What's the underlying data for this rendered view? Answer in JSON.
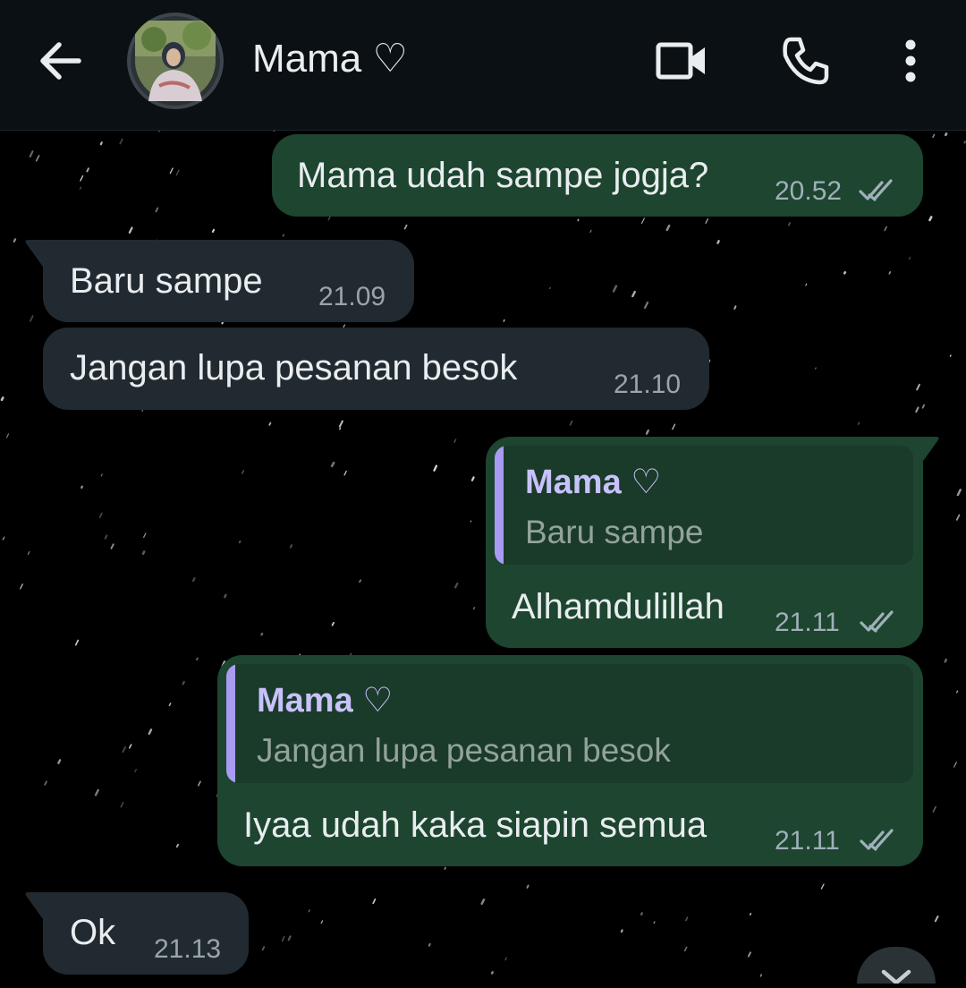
{
  "header": {
    "contact_name": "Mama ♡"
  },
  "icons": {
    "back": "arrow-left-icon",
    "avatar": "avatar",
    "video": "video-camera-icon",
    "call": "phone-icon",
    "menu": "more-vertical-icon",
    "read": "double-check-icon",
    "scroll": "chevron-down-icon"
  },
  "colors": {
    "outgoing_bubble": "#1d4530",
    "incoming_bubble": "#212a30",
    "quote_accent": "#a79cf2",
    "background": "#000000"
  },
  "messages": [
    {
      "direction": "outgoing",
      "text": "Mama udah sampe jogja?",
      "time": "20.52",
      "status": "read"
    },
    {
      "direction": "incoming",
      "text": "Baru sampe",
      "time": "21.09"
    },
    {
      "direction": "incoming",
      "text": "Jangan lupa  pesanan besok",
      "time": "21.10"
    },
    {
      "direction": "outgoing",
      "quote": {
        "author": "Mama ♡",
        "text": "Baru sampe"
      },
      "text": "Alhamdulillah",
      "time": "21.11",
      "status": "read"
    },
    {
      "direction": "outgoing",
      "quote": {
        "author": "Mama ♡",
        "text": "Jangan lupa  pesanan besok"
      },
      "text": "Iyaa udah kaka siapin semua",
      "time": "21.11",
      "status": "read"
    },
    {
      "direction": "incoming",
      "text": "Ok",
      "time": "21.13"
    }
  ]
}
